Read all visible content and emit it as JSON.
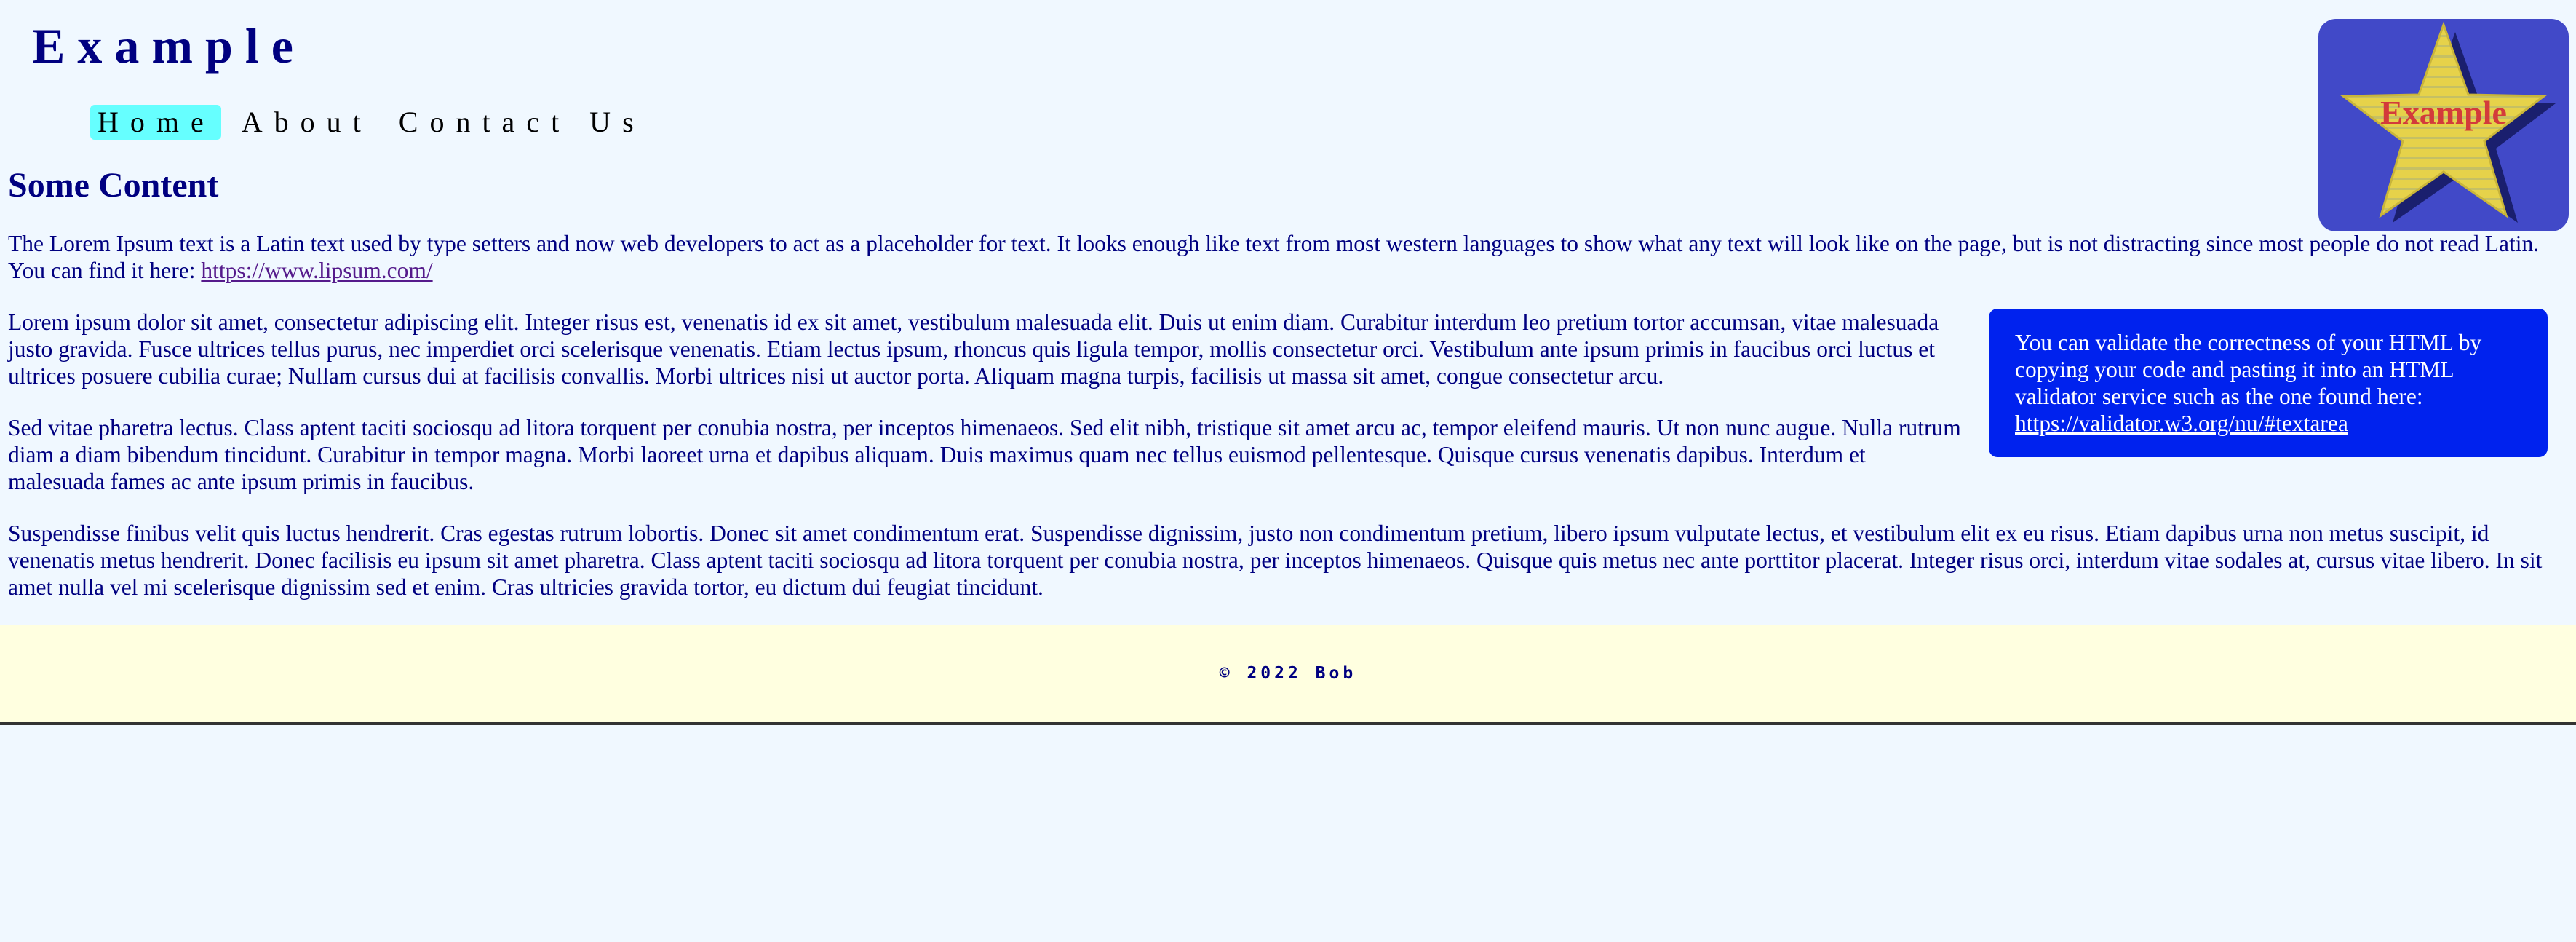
{
  "header": {
    "site_title": "Example",
    "logo_text": "Example"
  },
  "nav": {
    "items": [
      {
        "label": "Home",
        "active": true
      },
      {
        "label": "About",
        "active": false
      },
      {
        "label": "Contact Us",
        "active": false
      }
    ]
  },
  "main": {
    "heading": "Some Content",
    "intro": {
      "text": "The Lorem Ipsum text is a Latin text used by type setters and now web developers to act as a placeholder for text. It looks enough like text from most western languages to show what any text will look like on the page, but is not distracting since most people do not read Latin. You can find it here: ",
      "link": "https://www.lipsum.com/"
    },
    "aside": {
      "text": "You can validate the correctness of your HTML by copying your code and pasting it into an HTML validator service such as the one found here: ",
      "link": "https://validator.w3.org/nu/#textarea"
    },
    "paragraphs": [
      "Lorem ipsum dolor sit amet, consectetur adipiscing elit. Integer risus est, venenatis id ex sit amet, vestibulum malesuada elit. Duis ut enim diam. Curabitur interdum leo pretium tortor accumsan, vitae malesuada justo gravida. Fusce ultrices tellus purus, nec imperdiet orci scelerisque venenatis. Etiam lectus ipsum, rhoncus quis ligula tempor, mollis consectetur orci. Vestibulum ante ipsum primis in faucibus orci luctus et ultrices posuere cubilia curae; Nullam cursus dui at facilisis convallis. Morbi ultrices nisi ut auctor porta. Aliquam magna turpis, facilisis ut massa sit amet, congue consectetur arcu.",
      "Sed vitae pharetra lectus. Class aptent taciti sociosqu ad litora torquent per conubia nostra, per inceptos himenaeos. Sed elit nibh, tristique sit amet arcu ac, tempor eleifend mauris. Ut non nunc augue. Nulla rutrum diam a diam bibendum tincidunt. Curabitur in tempor magna. Morbi laoreet urna et dapibus aliquam. Duis maximus quam nec tellus euismod pellentesque. Quisque cursus venenatis dapibus. Interdum et malesuada fames ac ante ipsum primis in faucibus.",
      "Suspendisse finibus velit quis luctus hendrerit. Cras egestas rutrum lobortis. Donec sit amet condimentum erat. Suspendisse dignissim, justo non condimentum pretium, libero ipsum vulputate lectus, et vestibulum elit ex eu risus. Etiam dapibus urna non metus suscipit, id venenatis metus hendrerit. Donec facilisis eu ipsum sit amet pharetra. Class aptent taciti sociosqu ad litora torquent per conubia nostra, per inceptos himenaeos. Quisque quis metus nec ante porttitor placerat. Integer risus orci, interdum vitae sodales at, cursus vitae libero. In sit amet nulla vel mi scelerisque dignissim sed et enim. Cras ultricies gravida tortor, eu dictum dui feugiat tincidunt."
    ]
  },
  "footer": {
    "text": "© 2022 Bob"
  },
  "colors": {
    "page_background": "#f0f8ff",
    "text": "#000080",
    "nav_active": "#66ffff",
    "aside_background": "#0022ee",
    "footer_background": "#ffffe0",
    "logo_background": "#4149c8",
    "logo_star": "#e6d24a",
    "logo_text": "#d33b3b"
  }
}
